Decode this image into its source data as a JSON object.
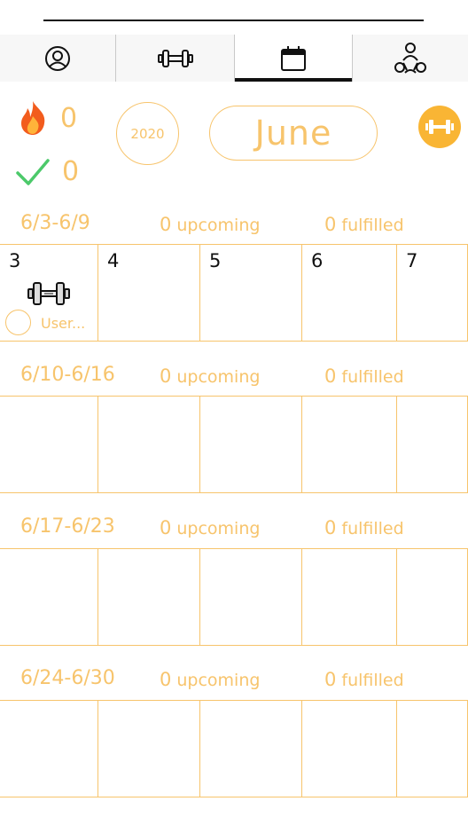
{
  "tabs": [
    {
      "name": "profile",
      "icon": "user-circle-icon",
      "active": false
    },
    {
      "name": "workouts",
      "icon": "dumbbell-icon",
      "active": false
    },
    {
      "name": "calendar",
      "icon": "calendar-icon",
      "active": true
    },
    {
      "name": "community",
      "icon": "people-group-icon",
      "active": false
    }
  ],
  "stats": {
    "streak": {
      "icon": "fire-icon",
      "value": "0"
    },
    "completed": {
      "icon": "checkmark-icon",
      "value": "0"
    }
  },
  "year": "2020",
  "month": "June",
  "weight_button_icon": "dumbbell-icon",
  "weeks": [
    {
      "range": "6/3-6/9",
      "upcoming": "0",
      "upcoming_label": "upcoming",
      "fulfilled": "0",
      "fulfilled_label": "fulfilled",
      "days": [
        {
          "day": "3",
          "has_workout": true,
          "user": "User..."
        },
        {
          "day": "4"
        },
        {
          "day": "5"
        },
        {
          "day": "6"
        },
        {
          "day": "7"
        }
      ]
    },
    {
      "range": "6/10-6/16",
      "upcoming": "0",
      "upcoming_label": "upcoming",
      "fulfilled": "0",
      "fulfilled_label": "fulfilled",
      "days": [
        {
          "day": ""
        },
        {
          "day": ""
        },
        {
          "day": ""
        },
        {
          "day": ""
        },
        {
          "day": ""
        }
      ]
    },
    {
      "range": "6/17-6/23",
      "upcoming": "0",
      "upcoming_label": "upcoming",
      "fulfilled": "0",
      "fulfilled_label": "fulfilled",
      "days": [
        {
          "day": ""
        },
        {
          "day": ""
        },
        {
          "day": ""
        },
        {
          "day": ""
        },
        {
          "day": ""
        }
      ]
    },
    {
      "range": "6/24-6/30",
      "upcoming": "0",
      "upcoming_label": "upcoming",
      "fulfilled": "0",
      "fulfilled_label": "fulfilled",
      "days": [
        {
          "day": ""
        },
        {
          "day": ""
        },
        {
          "day": ""
        },
        {
          "day": ""
        },
        {
          "day": ""
        }
      ]
    }
  ],
  "colors": {
    "accent": "#f7c46c",
    "accent_strong": "#f9b534",
    "check": "#4cc96a",
    "fire": "#f25c1d"
  }
}
